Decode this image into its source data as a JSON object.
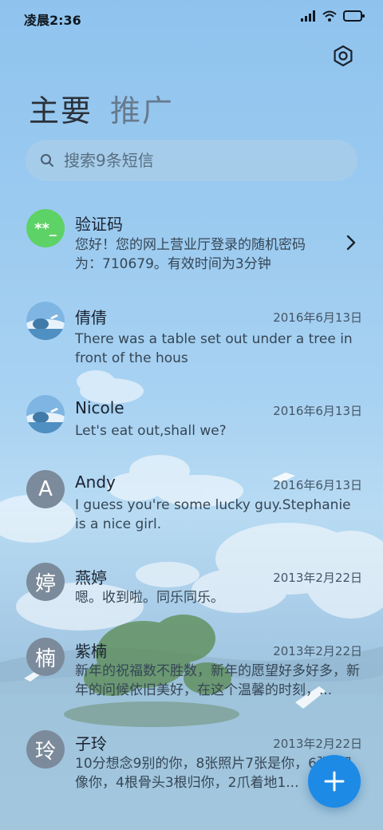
{
  "status_bar": {
    "time": "凌晨2:36"
  },
  "tabs": [
    {
      "label": "主要",
      "active": true
    },
    {
      "label": "推广",
      "active": false
    }
  ],
  "search": {
    "placeholder": "搜索9条短信"
  },
  "conversations": [
    {
      "name": "验证码",
      "avatar": "**_",
      "avatar_type": "code-green",
      "date": "",
      "preview": "您好！您的网上营业厅登录的随机密码为：710679。有效时间为3分钟"
    },
    {
      "name": "倩倩",
      "avatar_type": "photo",
      "date": "2016年6月13日",
      "preview": "There was a table set out under a tree in front of the hous"
    },
    {
      "name": "Nicole",
      "avatar_type": "photo",
      "date": "2016年6月13日",
      "preview": "Let's eat out,shall we?"
    },
    {
      "name": "Andy",
      "avatar": "A",
      "avatar_type": "letter",
      "date": "2016年6月13日",
      "preview": "I guess you're some lucky guy.Stephanie is a nice girl."
    },
    {
      "name": "燕婷",
      "avatar": "婷",
      "avatar_type": "letter",
      "date": "2013年2月22日",
      "preview": "嗯。收到啦。同乐同乐。"
    },
    {
      "name": "紫楠",
      "avatar": "楠",
      "avatar_type": "letter",
      "date": "2013年2月22日",
      "preview": "新年的祝福数不胜数，新年的愿望好多好多，新年的问候依旧美好，在这个温馨的时刻，..."
    },
    {
      "name": "子玲",
      "avatar": "玲",
      "avatar_type": "letter",
      "date": "2013年2月22日",
      "preview": "10分想念9别的你，8张照片7张是你，6张5只像你，4根骨头3根归你，2爪着地1..."
    }
  ],
  "colors": {
    "accent": "#1d8ae6",
    "code_avatar": "#5dd266",
    "letter_avatar": "#7c8b9b"
  },
  "icons": {
    "settings": "gear-icon",
    "search": "search-icon",
    "fab": "plus-icon",
    "chevron": "chevron-right-icon"
  }
}
